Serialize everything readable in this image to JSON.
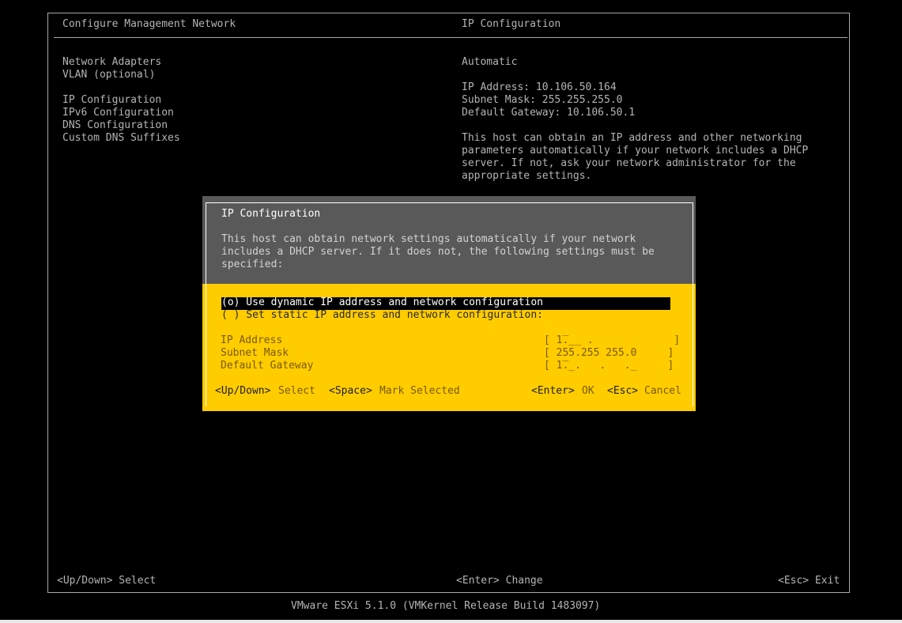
{
  "left_title": "Configure Management Network",
  "right_title": "IP Configuration",
  "menu_items": [
    "Network Adapters",
    "VLAN (optional)",
    "IP Configuration",
    "IPv6 Configuration",
    "DNS Configuration",
    "Custom DNS Suffixes"
  ],
  "info": {
    "mode": "Automatic",
    "ip_address": "IP Address: 10.106.50.164",
    "subnet_mask": "Subnet Mask: 255.255.255.0",
    "default_gateway": "Default Gateway: 10.106.50.1",
    "description_lines": [
      "This host can obtain an IP address and other networking",
      "parameters automatically if your network includes a DHCP",
      "server. If not, ask your network administrator for the",
      "appropriate settings."
    ]
  },
  "dialog": {
    "title": "IP Configuration",
    "description_lines": [
      "This host can obtain network settings automatically if your network",
      "includes a DHCP server. If it does not, the following settings must be",
      "specified:"
    ],
    "option_dynamic": "(o) Use dynamic IP address and network configuration",
    "option_static": "( ) Set static IP address and network configuration:",
    "fields": [
      {
        "label": "IP Address",
        "value": "[ 1̅.̲̲ .             ]"
      },
      {
        "label": "Subnet Mask",
        "value": "[ 255.255 255.0     ]"
      },
      {
        "label": "Default Gateway",
        "value": "[ 1̅.̲.   .   .̲     ]"
      }
    ],
    "hint_left_key1": "<Up/Down>",
    "hint_left_text1": "Select",
    "hint_left_key2": "<Space>",
    "hint_left_text2": "Mark Selected",
    "hint_right_key1": "<Enter>",
    "hint_right_text1": "OK",
    "hint_right_key2": "<Esc>",
    "hint_right_text2": "Cancel"
  },
  "footer": {
    "select": "<Up/Down> Select",
    "change": "<Enter> Change",
    "exit": "<Esc> Exit",
    "version": "VMware ESXi 5.1.0 (VMKernel Release Build 1483097)"
  }
}
